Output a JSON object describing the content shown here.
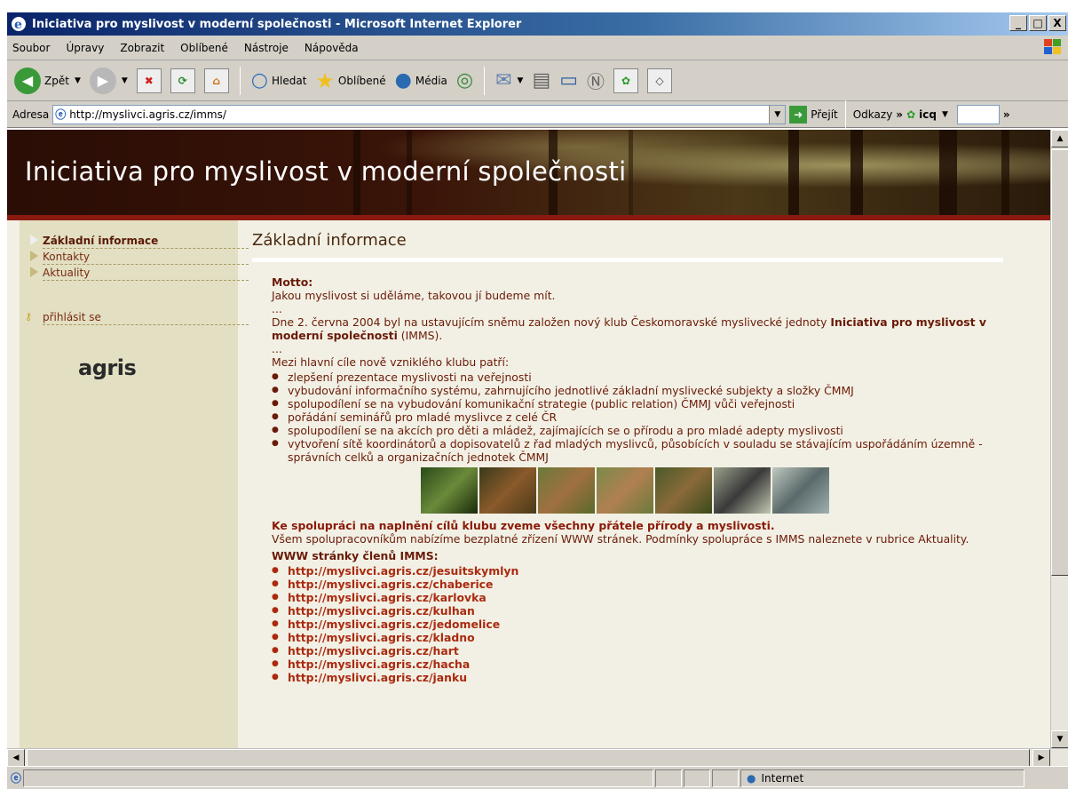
{
  "window": {
    "title": "Iniciativa pro myslivost v moderní společnosti - Microsoft Internet Explorer",
    "buttons": [
      "_",
      "□",
      "X"
    ]
  },
  "menu": [
    "Soubor",
    "Úpravy",
    "Zobrazit",
    "Oblíbené",
    "Nástroje",
    "Nápověda"
  ],
  "toolbar": {
    "back": "Zpět",
    "search": "Hledat",
    "favorites": "Oblíbené",
    "media": "Média"
  },
  "address": {
    "label": "Adresa",
    "url": "http://myslivci.agris.cz/imms/",
    "go": "Přejít",
    "links": "Odkazy",
    "icq": "icq"
  },
  "banner": {
    "title": "Iniciativa pro myslivost v moderní společnosti"
  },
  "nav": {
    "items": [
      "Základní informace",
      "Kontakty",
      "Aktuality"
    ],
    "login": "přihlásit se",
    "logo": "agris"
  },
  "content": {
    "heading": "Základní informace",
    "motto_label": "Motto:",
    "motto_text": "Jakou myslivost si uděláme, takovou jí budeme mít.",
    "ellipsis": "...",
    "intro_pre": "Dne 2. června 2004 byl na ustavujícím sněmu založen nový klub Českomoravské myslivecké jednoty ",
    "intro_bold": "Iniciativa pro myslivost v moderní společnosti",
    "intro_post": " (IMMS).",
    "goals_label": "Mezi hlavní cíle nově vzniklého klubu patří:",
    "goals": [
      "zlepšení prezentace myslivosti na veřejnosti",
      "vybudování informačního systému, zahrnujícího jednotlivé základní myslivecké subjekty a složky ČMMJ",
      "spolupodílení se na vybudování komunikační strategie (public relation) ČMMJ vůči veřejnosti",
      "pořádání seminářů pro mladé myslivce z celé ČR",
      "spolupodílení se na akcích pro děti a mládež, zajímajících se o přírodu a pro mladé adepty myslivosti",
      "vytvoření sítě koordinátorů a dopisovatelů z řad mladých myslivců, působících v souladu se stávajícím uspořádáním územně - správních celků a organizačních jednotek ČMMJ"
    ],
    "invite": "Ke spolupráci na naplnění cílů klubu zveme všechny přátele přírody a myslivosti.",
    "offer": "Všem spolupracovníkům nabízíme bezplatné zřízení WWW stránek. Podmínky spolupráce s IMMS naleznete v rubrice Aktuality.",
    "members_label": "WWW stránky členů IMMS:",
    "member_links": [
      "http://myslivci.agris.cz/jesuitskymlyn",
      "http://myslivci.agris.cz/chaberice",
      "http://myslivci.agris.cz/karlovka",
      "http://myslivci.agris.cz/kulhan",
      "http://myslivci.agris.cz/jedomelice",
      "http://myslivci.agris.cz/kladno",
      "http://myslivci.agris.cz/hart",
      "http://myslivci.agris.cz/hacha",
      "http://myslivci.agris.cz/janku"
    ]
  },
  "status": {
    "zone": "Internet"
  },
  "colors": {
    "titlebar": "#0a246a",
    "banner_line": "#8a1a10",
    "text": "#6a1a08",
    "link": "#aa2a10",
    "sidebar": "#e2dfc2"
  }
}
